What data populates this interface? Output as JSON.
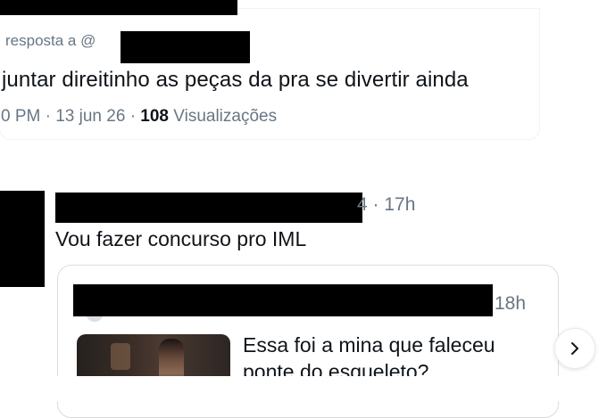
{
  "top_tweet": {
    "reply_prefix": "resposta a @",
    "body": "juntar direitinho as peças da pra se divertir ainda",
    "meta_prefix": "0 PM · 13 jun 26 · ",
    "view_count": "108",
    "views_label": " Visualizações"
  },
  "reply_tweet": {
    "time": "4 · 17h",
    "body": "Vou fazer concurso pro IML"
  },
  "quoted_tweet": {
    "time": "18h",
    "line1": "Essa foi a mina que faleceu",
    "line2": "ponte do esqueleto?"
  },
  "icons": {
    "next": "chevron-right-icon",
    "avatar": "avatar"
  },
  "colors": {
    "text": "#0f1419",
    "secondary": "#687684",
    "border": "#d6dde3"
  }
}
